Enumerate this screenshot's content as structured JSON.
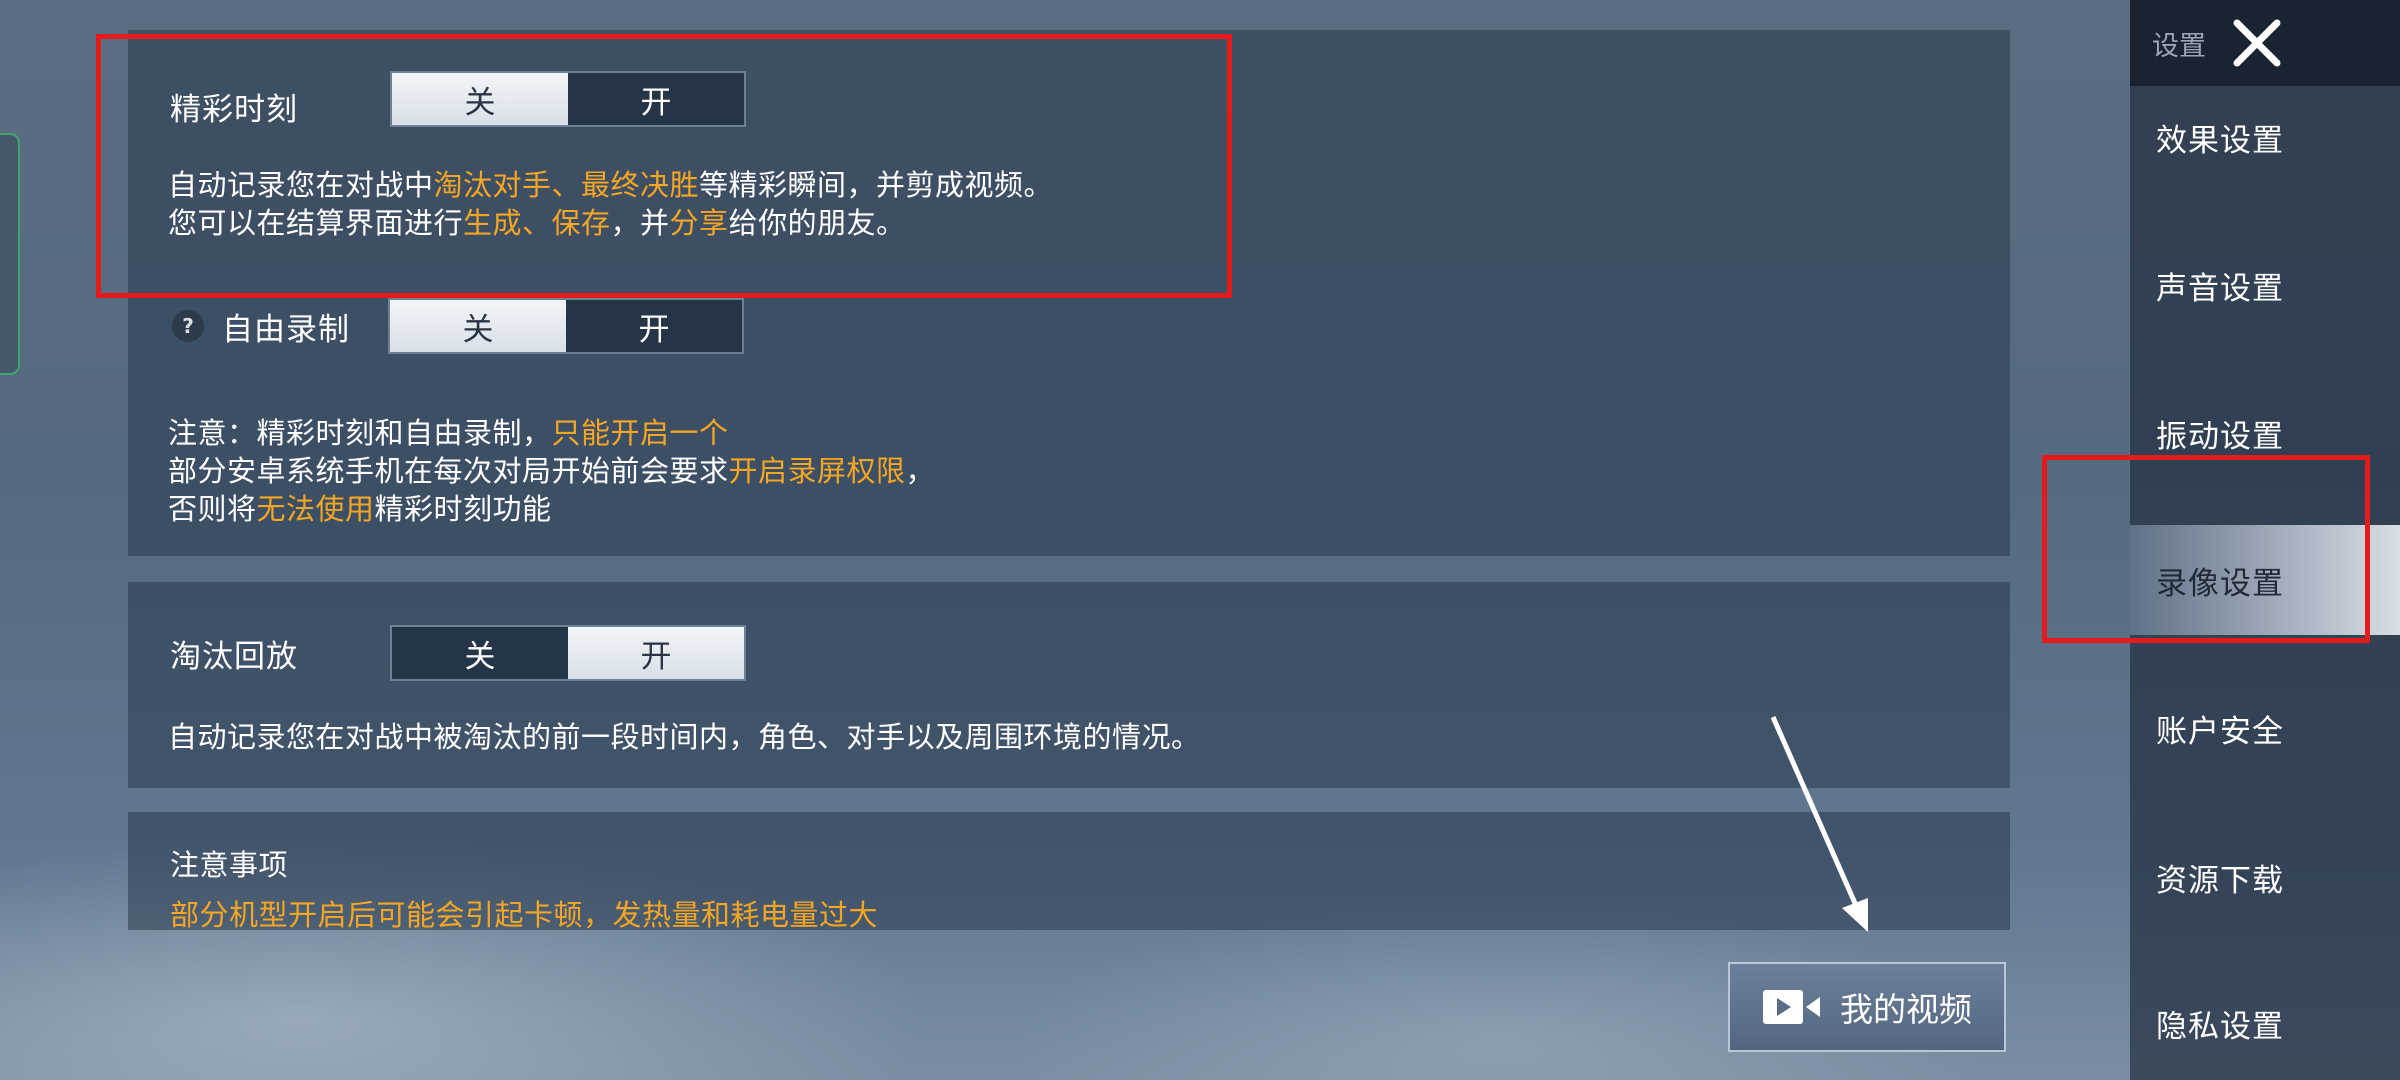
{
  "sidebar": {
    "title": "设置",
    "close_icon": "close-icon",
    "items": [
      {
        "label": "效果设置",
        "active": false
      },
      {
        "label": "声音设置",
        "active": false
      },
      {
        "label": "振动设置",
        "active": false
      },
      {
        "label": "录像设置",
        "active": true
      },
      {
        "label": "账户安全",
        "active": false
      },
      {
        "label": "资源下载",
        "active": false
      },
      {
        "label": "隐私设置",
        "active": false
      }
    ]
  },
  "highlights": {
    "label": "精彩时刻",
    "toggle": {
      "off": "关",
      "on": "开",
      "selected": "off"
    },
    "desc_line1": {
      "p1": "自动记录您在对战中",
      "h1": "淘汰对手、最终决胜",
      "p2": "等精彩瞬间，并剪成视频。"
    },
    "desc_line2": {
      "p1": "您可以在结算界面进行",
      "h1": "生成、保存",
      "p2": "，并",
      "h2": "分享",
      "p3": "给你的朋友。"
    }
  },
  "free_record": {
    "help_icon": "question-icon",
    "help_text": "?",
    "label": "自由录制",
    "toggle": {
      "off": "关",
      "on": "开",
      "selected": "off"
    }
  },
  "note": {
    "line1": {
      "p1": "注意：精彩时刻和自由录制，",
      "h1": "只能开启一个"
    },
    "line2": {
      "p1": "部分安卓系统手机在每次对局开始前会要求",
      "h1": "开启录屏权限",
      "p2": "，"
    },
    "line3": {
      "p1": "否则将",
      "h1": "无法使用",
      "p2": "精彩时刻功能"
    }
  },
  "elimination_replay": {
    "label": "淘汰回放",
    "toggle": {
      "off": "关",
      "on": "开",
      "selected": "on"
    },
    "desc": "自动记录您在对战中被淘汰的前一段时间内，角色、对手以及周围环境的情况。"
  },
  "notice": {
    "title": "注意事项",
    "text": "部分机型开启后可能会引起卡顿，发热量和耗电量过大"
  },
  "my_video_button": {
    "icon": "video-camera-icon",
    "label": "我的视频"
  },
  "colors": {
    "highlight": "#f5a623",
    "annotation_red": "#e41b1b"
  }
}
